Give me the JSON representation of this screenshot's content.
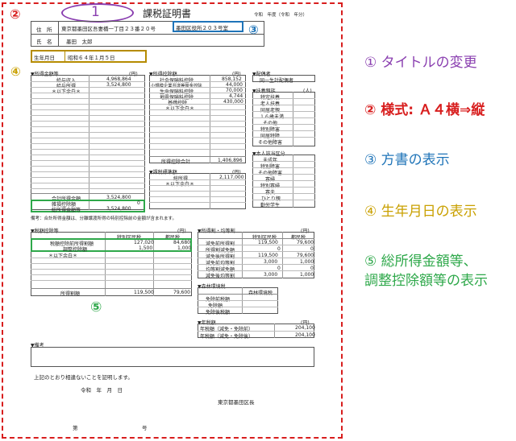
{
  "colors": {
    "red": "#d81e1e",
    "purple": "#8a3fb0",
    "blue": "#1f74b8",
    "gold": "#c9a000",
    "green": "#2ea84a"
  },
  "markers": {
    "m1": "①",
    "m2": "②",
    "m3": "③",
    "m4": "④",
    "m5": "⑤",
    "title_num": "1"
  },
  "doc": {
    "title": "課税証明書",
    "year": "令和　年度（令和　年分）",
    "address_label": "住　所",
    "address": "東京都墨田区吾妻橋一丁目２３番２０号",
    "katagaki": "墨田区役所２０３号室",
    "name_label": "氏　名",
    "name": "墨田　太郎",
    "birth_label": "生年月日",
    "birth": "昭和６４年１月５日",
    "income": {
      "header": "▼所得金額等",
      "unit": "(円)",
      "rows": [
        {
          "label": "給与収入",
          "value": "4,968,864"
        },
        {
          "label": "給与所得",
          "value": "3,524,800"
        }
      ],
      "rest": "＊以下余白＊",
      "total_label": "合計所得金額",
      "total": "3,524,800",
      "adj_label": "雑損控除額",
      "adj": "0",
      "sum_label": "総所得金額等",
      "sum": "3,524,800"
    },
    "deduct": {
      "header": "▼所得控除額",
      "unit": "(円)",
      "rows": [
        {
          "label": "社会保険料控除",
          "value": "858,152"
        },
        {
          "label": "小規模企業共済等掛金控除",
          "value": "44,000"
        },
        {
          "label": "生命保険料控除",
          "value": "70,000"
        },
        {
          "label": "地震保険料控除",
          "value": "4,744"
        },
        {
          "label": "基礎控除",
          "value": "430,000"
        }
      ],
      "rest": "＊以下余白＊",
      "total_label": "所得控除合計",
      "total": "1,406,896"
    },
    "taxable": {
      "header": "▼課税標準額",
      "unit": "(円)",
      "rows": [
        {
          "label": "総所得",
          "value": "2,117,000"
        }
      ],
      "rest": "＊以下余白＊"
    },
    "spouse": {
      "header": "▼配偶者",
      "value": "同一生計配偶者"
    },
    "dependents": {
      "header": "▼扶養親族",
      "unit": "(人)",
      "rows": [
        "特定扶養",
        "老人扶養",
        "同居老親",
        "１６歳未満",
        "その他",
        "特別障害",
        "同居特障",
        "その他障害"
      ]
    },
    "self_cat": {
      "header": "▼本人該当区分",
      "rows": [
        "未成年",
        "特別障害",
        "その他障害",
        "寡婦",
        "特別寡婦",
        "寡夫",
        "ひとり親",
        "勤労学生"
      ]
    },
    "remark": "備考：合計所得金額は、分離譲渡所得の特別控除前の金額が含まれます。",
    "taxcredit": {
      "header": "▼税額控除等",
      "col1": "特別区民税",
      "col2": "都民税",
      "unit": "(円)",
      "rows": [
        {
          "label": "税額控除前所得割額",
          "v1": "127,020",
          "v2": "84,680"
        },
        {
          "label": "調整控除額",
          "v1": "1,500",
          "v2": "1,000"
        }
      ],
      "rest": "＊以下余白＊",
      "total_label": "所得割額",
      "t1": "119,500",
      "t2": "79,600"
    },
    "levy": {
      "header": "▼所得割・均等割",
      "unit": "(円)",
      "col1": "特別区民税",
      "col2": "都民税",
      "rows": [
        {
          "label": "減免前所得割",
          "v1": "119,500",
          "v2": "79,600"
        },
        {
          "label": "所得割減免額",
          "v1": "0",
          "v2": "0"
        },
        {
          "label": "減免後所得割",
          "v1": "119,500",
          "v2": "79,600"
        },
        {
          "label": "減免前均等割",
          "v1": "3,000",
          "v2": "1,000"
        },
        {
          "label": "均等割減免額",
          "v1": "0",
          "v2": "0"
        },
        {
          "label": "減免後均等割",
          "v1": "3,000",
          "v2": "1,000"
        }
      ]
    },
    "forest": {
      "header": "▼森林環境税",
      "col": "森林環境税",
      "rows": [
        "免除前税額",
        "免除額",
        "免除後税額"
      ]
    },
    "annual": {
      "header": "▼年税額",
      "unit": "(円)",
      "rows": [
        {
          "label": "年税額（減免・免除前）",
          "value": "204,100"
        },
        {
          "label": "年税額（減免・免除後）",
          "value": "204,100"
        }
      ]
    },
    "bikou": "▼備考",
    "cert": "上記のとおり相違ないことを証明します。",
    "date": "令和　年　月　日",
    "issuer": "東京都墨田区長",
    "number_label": "第",
    "number_suffix": "号"
  },
  "notes": [
    "① タイトルの変更",
    "② 様式: Ａ４横⇒縦",
    "③ 方書の表示",
    "④ 生年月日の表示",
    "⑤ 総所得金額等、",
    "調整控除額等の表示"
  ]
}
